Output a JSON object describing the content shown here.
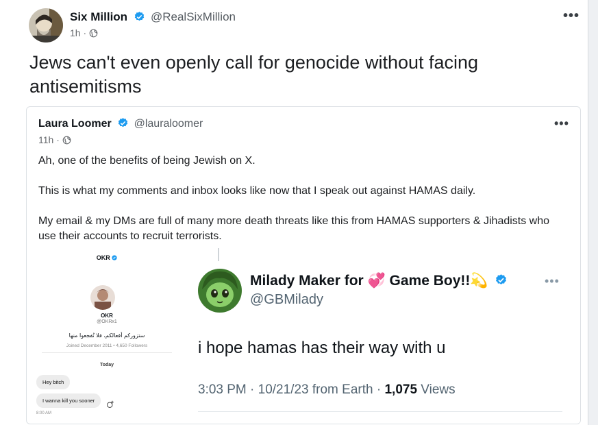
{
  "post": {
    "author_name": "Six Million",
    "author_handle": "@RealSixMillion",
    "time": "1h",
    "more_label": "•••",
    "text": "Jews can't even openly call for genocide without facing antisemitisms"
  },
  "quote": {
    "author_name": "Laura Loomer",
    "author_handle": "@lauraloomer",
    "time": "11h",
    "more_label": "•••",
    "paragraphs": [
      "Ah, one of the benefits of being Jewish on X.",
      "This is what my comments and inbox looks like now that I speak out against HAMAS daily.",
      "My email & my DMs are full of many more death threats like this from HAMAS supporters & Jihadists who use their accounts to recruit terrorists."
    ]
  },
  "dm_screenshot": {
    "title": "OKR",
    "name": "OKR",
    "handle": "@OKRx1",
    "bio": "ستزوركم أفعالكم، فلا تُفجعوا منها",
    "joined": "Joined December 2011 • 4,650 Followers",
    "today": "Today",
    "messages": [
      "Hey bitch",
      "I wanna kill you sooner"
    ],
    "time": "8:00 AM"
  },
  "tweet_screenshot": {
    "name": "Milady Maker for 💞 Game Boy!!💫",
    "handle": "@GBMilady",
    "more_label": "•••",
    "text": "i hope hamas has their way with u",
    "meta_prefix": "3:03 PM · 10/21/23 from Earth · ",
    "views_count": "1,075",
    "views_label": " Views"
  },
  "colors": {
    "verified_blue": "#1d9bf0",
    "background": "#eef0f3",
    "secondary_text": "#65686c"
  },
  "icons": [
    "verified-badge-icon",
    "globe-icon",
    "more-icon"
  ]
}
